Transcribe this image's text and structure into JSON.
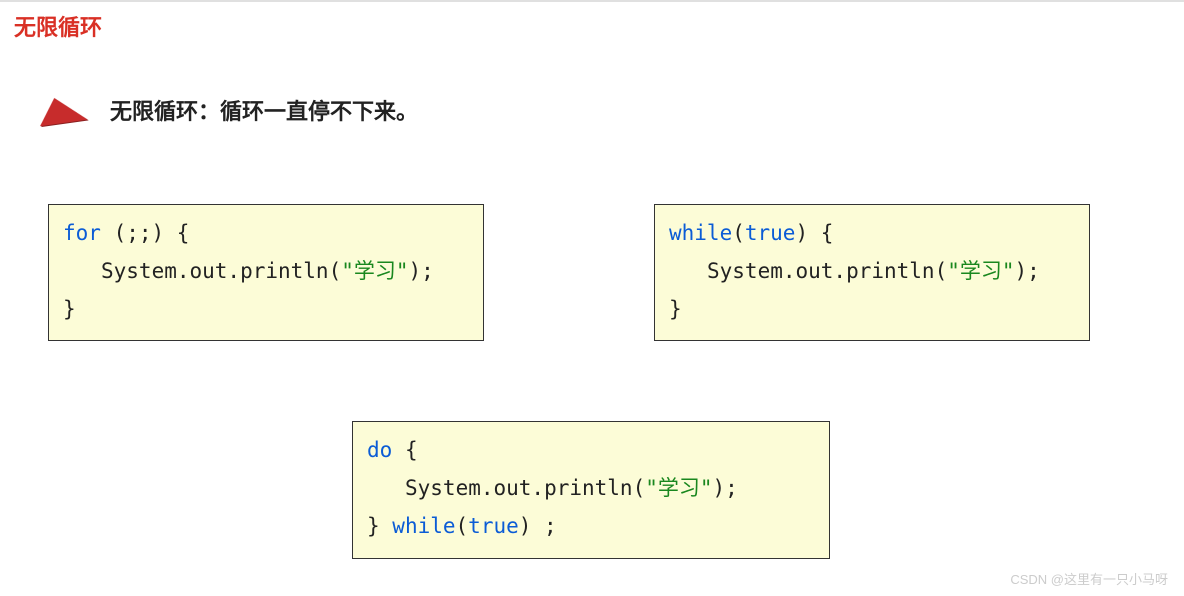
{
  "page_title": "无限循环",
  "subtitle": "无限循环：循环一直停不下来。",
  "code_boxes": {
    "for_loop": {
      "line1_kw": "for",
      "line1_rest": " (;;) {",
      "line2_pre": "System.out.println(",
      "line2_str": "\"学习\"",
      "line2_post": ");",
      "line3": "}"
    },
    "while_loop": {
      "line1_kw": "while",
      "line1_paren_open": "(",
      "line1_true": "true",
      "line1_paren_close": ") {",
      "line2_pre": "System.out.println(",
      "line2_str": "\"学习\"",
      "line2_post": ");",
      "line3": "}"
    },
    "do_while": {
      "line1_kw": "do",
      "line1_rest": " {",
      "line2_pre": "System.out.println(",
      "line2_str": "\"学习\"",
      "line2_post": ");",
      "line3_close": "} ",
      "line3_kw": "while",
      "line3_paren_open": "(",
      "line3_true": "true",
      "line3_end": ") ;"
    }
  },
  "watermark": "CSDN @这里有一只小马呀"
}
